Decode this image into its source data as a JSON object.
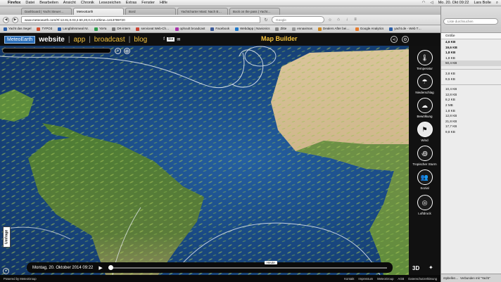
{
  "menubar": {
    "apple": "",
    "app": "Firefox",
    "items": [
      "Datei",
      "Bearbeiten",
      "Ansicht",
      "Chronik",
      "Lesezeichen",
      "Extras",
      "Fenster",
      "Hilfe"
    ],
    "clock": "Mo. 20. Okt 09:22",
    "user": "Lars Bolle"
  },
  "browser": {
    "tabs": [
      "Dashboard | Yacht Steuer…",
      "MeteoEarth",
      "Bord",
      "Yachtcharter Mast: Nach B…",
      "Bock on the pass | Yacht…"
    ],
    "active_tab": 1,
    "url": "www.meteoearth.com/#/-12.81,0.03,2.50,20,0,0,0,0/time=1413789720",
    "search_placeholder": "Google",
    "bookmarks": [
      "Yacht das Segel",
      "TYPO3",
      "Langfahrsmeal Nr.",
      "YaYa",
      "DK-intern",
      "serviceat Web-Ch…",
      "ophoult broadcast",
      "Facebook",
      "Webdapp | Navionics",
      "Zitte",
      "ennaximas",
      "Dealers After bei…",
      "Google Analytics",
      "yacht.de - Web T…"
    ]
  },
  "site": {
    "logo": "MeteoEarth",
    "nav": {
      "main": "website",
      "app": "app",
      "broadcast": "broadcast",
      "blog": "blog"
    },
    "fb": "like",
    "map_builder": "Map Builder",
    "umfrage": "Umfrage",
    "timebar": {
      "date": "Montag, 20. Oktober 2014 09:22",
      "heute": "Heute",
      "progress": 0.0
    },
    "sidebar": [
      {
        "label": "Temperatur",
        "glyph": "🌡",
        "active": false
      },
      {
        "label": "Niederschlag",
        "glyph": "☂",
        "active": false
      },
      {
        "label": "Bewölkung",
        "glyph": "☁",
        "active": false
      },
      {
        "label": "Wind",
        "glyph": "⚑",
        "active": true
      },
      {
        "label": "Tropischer Sturm",
        "glyph": "꩜",
        "active": false
      },
      {
        "label": "Sozial",
        "glyph": "👥",
        "active": false
      },
      {
        "label": "Luftdruck",
        "glyph": "◎",
        "active": false
      }
    ],
    "three_d": "3D",
    "footer": {
      "powered": "Powered by MeteoGroup",
      "links": [
        "Kontakt",
        "Impressum",
        "MeteoGroup",
        "AGB",
        "Datenschutzerklärung"
      ]
    }
  },
  "downloads": {
    "search_placeholder": "Liste durchsuchen",
    "column": "Größe",
    "group1": [
      {
        "size": "4,6 KB",
        "bold": true
      },
      {
        "size": "19,6 KB",
        "bold": true
      },
      {
        "size": "1,8 KB",
        "bold": true
      },
      {
        "size": "1,8 KB",
        "bold": false
      },
      {
        "size": "50,4 KB",
        "bold": false,
        "sel": true
      }
    ],
    "group2": [
      {
        "size": "3,8 KB"
      },
      {
        "size": "9,5 KB"
      }
    ],
    "group3": [
      {
        "size": "10,4 KB"
      },
      {
        "size": "12,8 KB"
      },
      {
        "size": "8,2 KB"
      },
      {
        "size": "2 MB"
      },
      {
        "size": "1,8 KB"
      },
      {
        "size": "12,8 KB"
      },
      {
        "size": "21,8 KB"
      },
      {
        "size": "17,7 KB"
      },
      {
        "size": "9,8 KB"
      }
    ],
    "bottom_items": [
      "Verbunden mit \"Yacht\"",
      "ntpbellen..."
    ]
  }
}
